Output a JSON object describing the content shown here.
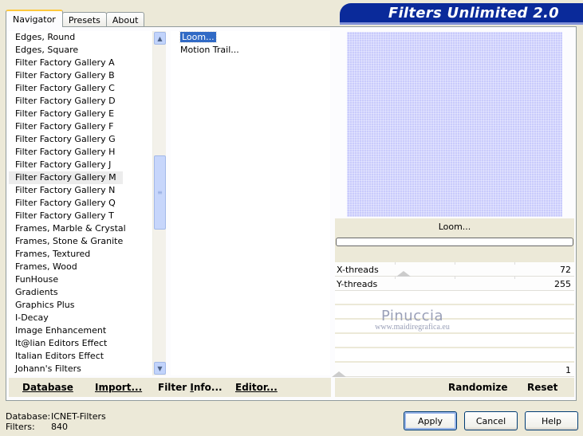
{
  "window": {
    "banner_title": "Filters Unlimited 2.0"
  },
  "tabs": [
    {
      "label": "Navigator",
      "active": true
    },
    {
      "label": "Presets",
      "active": false
    },
    {
      "label": "About",
      "active": false
    }
  ],
  "categories": [
    "Edges, Round",
    "Edges, Square",
    "Filter Factory Gallery A",
    "Filter Factory Gallery B",
    "Filter Factory Gallery C",
    "Filter Factory Gallery D",
    "Filter Factory Gallery E",
    "Filter Factory Gallery F",
    "Filter Factory Gallery G",
    "Filter Factory Gallery H",
    "Filter Factory Gallery J",
    "Filter Factory Gallery M",
    "Filter Factory Gallery N",
    "Filter Factory Gallery Q",
    "Filter Factory Gallery T",
    "Frames, Marble & Crystal",
    "Frames, Stone & Granite",
    "Frames, Textured",
    "Frames, Wood",
    "FunHouse",
    "Gradients",
    "Graphics Plus",
    "I-Decay",
    "Image Enhancement",
    "It@lian Editors Effect",
    "Italian Editors Effect",
    "Johann's Filters"
  ],
  "selected_category": "Filter Factory Gallery M",
  "filters": [
    {
      "label": "Loom...",
      "selected": true
    },
    {
      "label": "Motion Trail...",
      "selected": false
    }
  ],
  "preview": {
    "filter_name": "Loom...",
    "color": "#c9cbfc"
  },
  "sliders": [
    {
      "label": "X-threads",
      "value": "72"
    },
    {
      "label": "Y-threads",
      "value": "255"
    },
    {
      "label": "",
      "value": "1"
    }
  ],
  "watermark": {
    "line1": "Pinuccia",
    "line2": "www.maidiregrafica.eu"
  },
  "bottom_left_buttons": {
    "database": {
      "u": "D",
      "rest": "atabase"
    },
    "import": {
      "u": "I",
      "rest": "mport..."
    },
    "filter_info": {
      "a": "Filter ",
      "u": "I",
      "rest": "nfo..."
    },
    "editor": {
      "u": "E",
      "rest": "ditor..."
    }
  },
  "bottom_right_buttons": {
    "randomize": "Randomize",
    "reset": "Reset"
  },
  "status": {
    "database_label": "Database:",
    "database_value": "ICNET-Filters",
    "filters_label": "Filters:",
    "filters_value": "840"
  },
  "dialog_buttons": {
    "apply": "Apply",
    "cancel": "Cancel",
    "help": "Help"
  }
}
